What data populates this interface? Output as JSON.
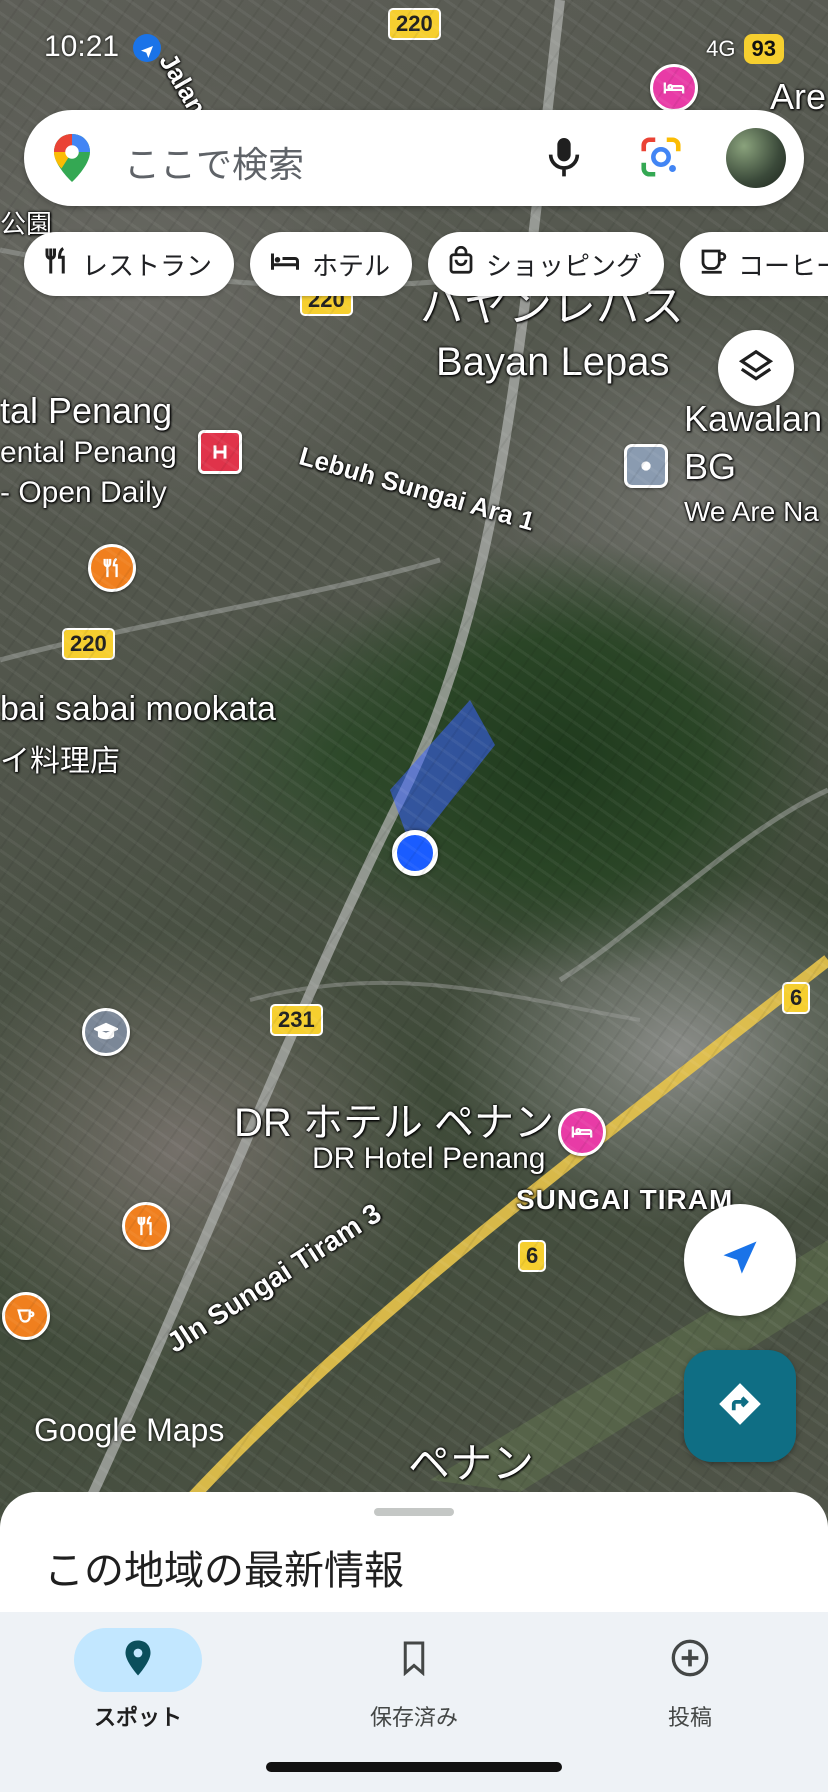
{
  "status": {
    "time": "10:21",
    "network": "4G",
    "battery": "93"
  },
  "search": {
    "placeholder": "ここで検索"
  },
  "chips": [
    {
      "label": "レストラン",
      "icon": "fork-knife-icon"
    },
    {
      "label": "ホテル",
      "icon": "bed-icon"
    },
    {
      "label": "ショッピング",
      "icon": "shopping-bag-icon"
    },
    {
      "label": "コーヒー",
      "icon": "coffee-cup-icon"
    }
  ],
  "map": {
    "labels": {
      "bayan_jp": "バヤンレパス",
      "bayan_en": "Bayan Lepas",
      "oriental1": "tal Penang",
      "oriental2": "ental Penang",
      "oriental3": "- Open Daily",
      "lebuh": "Lebuh Sungai Ara 1",
      "kawalan": "Kawalan",
      "bg": "BG",
      "wearena": "We Are Na",
      "sabai1": "bai sabai mookata",
      "sabai2": "イ料理店",
      "dr_jp": "DR ホテル ペナン",
      "dr_en": "DR Hotel Penang",
      "sungai_tiram": "SUNGAI TIRAM",
      "jln_tiram": "Jln Sungai Tiram 3",
      "penang_jp": "ペナン",
      "jalan_top": "Jalan S",
      "are_top": "Are",
      "koen": "公園"
    },
    "shields": {
      "r220a": "220",
      "r220b": "220",
      "r220c": "220",
      "r231": "231",
      "r6a": "6",
      "r6b": "6"
    },
    "watermark": "Google Maps"
  },
  "sheet": {
    "title": "この地域の最新情報"
  },
  "nav": [
    {
      "label": "スポット",
      "icon": "pin-icon",
      "active": true
    },
    {
      "label": "保存済み",
      "icon": "bookmark-icon",
      "active": false
    },
    {
      "label": "投稿",
      "icon": "add-circle-icon",
      "active": false
    }
  ],
  "colors": {
    "accent": "#1a73e8",
    "directions": "#0f6e84",
    "nav_active": "#c2e7ff",
    "route_shield": "#f6cf2f"
  }
}
